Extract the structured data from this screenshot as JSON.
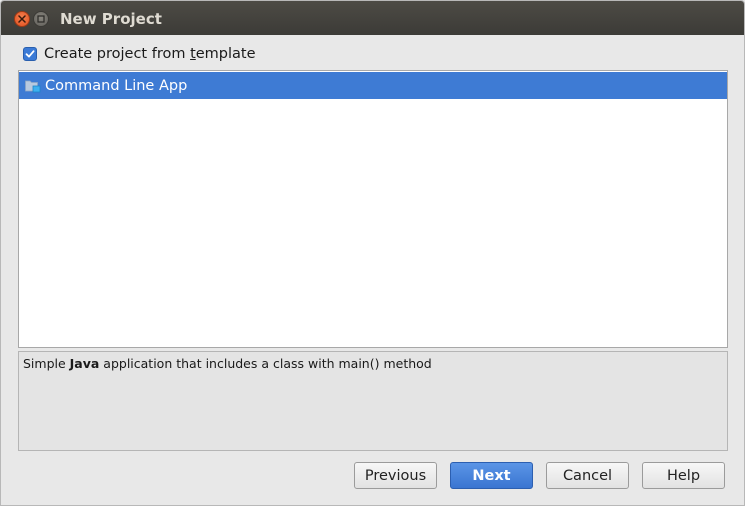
{
  "window": {
    "title": "New Project",
    "close_icon": "close-icon",
    "maximize_icon": "maximize-icon"
  },
  "template_checkbox": {
    "checked": true,
    "label_before": "Create project from ",
    "label_mnemonic": "t",
    "label_after": "emplate"
  },
  "templates": {
    "selected_index": 0,
    "items": [
      {
        "label": "Command Line App",
        "icon": "folder-icon"
      }
    ]
  },
  "description": {
    "prefix": "Simple ",
    "bold": "Java",
    "suffix": " application that includes a class with main() method"
  },
  "buttons": {
    "previous": "Previous",
    "next": "Next",
    "cancel": "Cancel",
    "help": "Help"
  },
  "colors": {
    "titlebar": "#3c3b37",
    "selection": "#3e7bd4",
    "primary_button": "#3a75d1",
    "close_button": "#e04f1f"
  }
}
